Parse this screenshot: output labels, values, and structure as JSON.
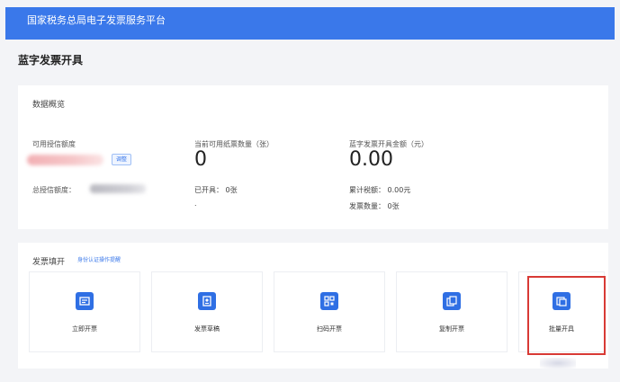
{
  "header": {
    "title": "国家税务总局电子发票服务平台"
  },
  "page": {
    "title": "蓝字发票开具"
  },
  "overview": {
    "title": "数据概览",
    "available_credit_label": "可用授信额度",
    "adjust_button": "调整",
    "paper_count_label": "当前可用纸票数量（张）",
    "paper_count_value": "0",
    "blue_amount_label": "蓝字发票开具金额（元）",
    "blue_amount_value": "0.00",
    "total_credit_label": "总授信额度：",
    "issued_label": "已开具：",
    "issued_value": "0张",
    "issued_sub": ".",
    "tax_label": "累计税额：",
    "tax_value": "0.00元",
    "invoice_count_label": "发票数量：",
    "invoice_count_value": "0张"
  },
  "fill": {
    "title": "发票填开",
    "help_link": "身份认证操作提醒",
    "tiles": [
      {
        "label": "立即开票",
        "icon": "invoice-now-icon"
      },
      {
        "label": "发票草稿",
        "icon": "draft-icon"
      },
      {
        "label": "扫码开票",
        "icon": "qr-scan-icon"
      },
      {
        "label": "复制开票",
        "icon": "copy-invoice-icon"
      },
      {
        "label": "批量开具",
        "icon": "batch-issue-icon"
      }
    ]
  },
  "colors": {
    "brand": "#3a78ea",
    "highlight": "#d83a35"
  }
}
